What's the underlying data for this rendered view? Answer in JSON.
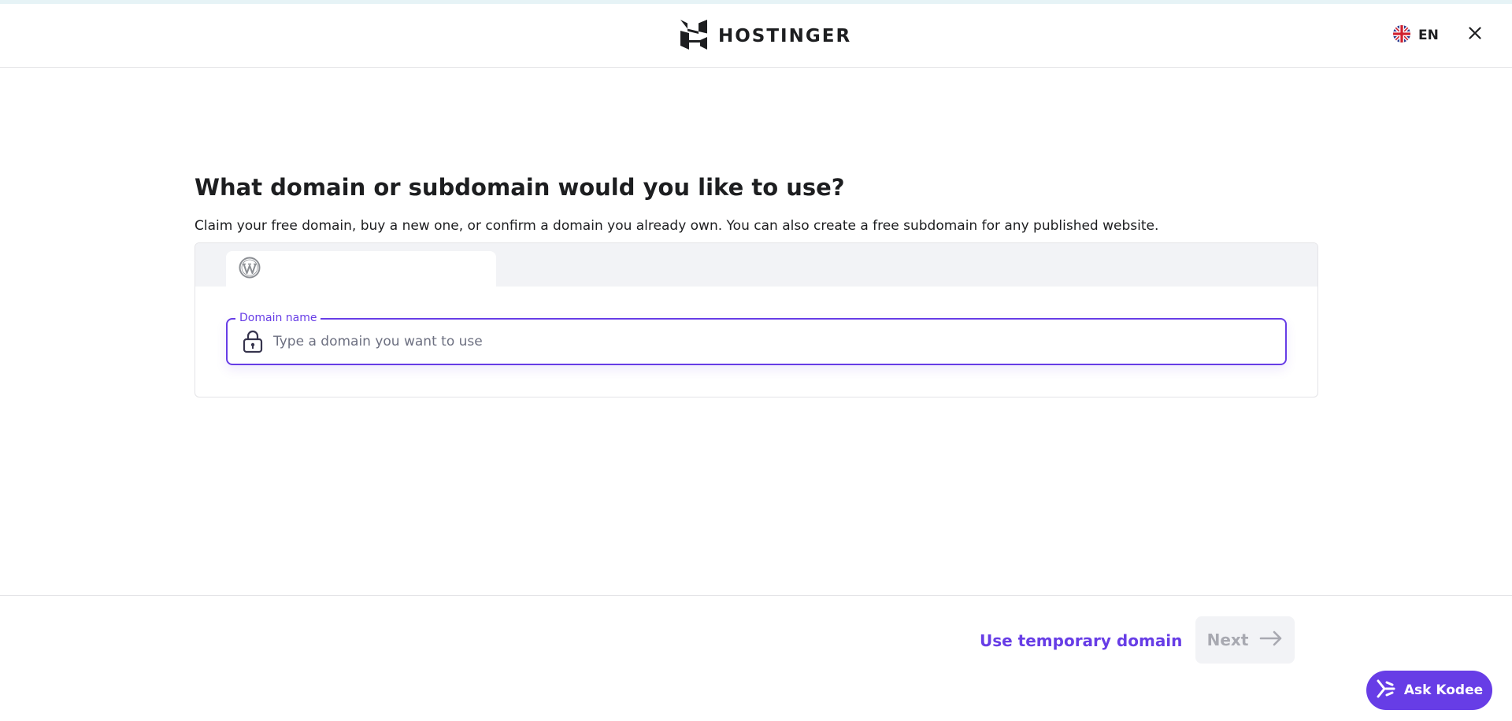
{
  "header": {
    "logo_text": "HOSTINGER",
    "language": "EN"
  },
  "main": {
    "title": "What domain or subdomain would you like to use?",
    "subtitle": "Claim your free domain, buy a new one, or confirm a domain you already own. You can also create a free subdomain for any published website.",
    "domain_field": {
      "label": "Domain name",
      "placeholder": "Type a domain you want to use",
      "value": ""
    }
  },
  "footer": {
    "temp_domain_label": "Use temporary domain",
    "next_label": "Next"
  },
  "assistant": {
    "label": "Ask Kodee"
  },
  "colors": {
    "accent": "#673de6",
    "disabled_text": "#a8a9b1",
    "disabled_bg": "#f2f3f6"
  },
  "icons": [
    "hostinger-logo-icon",
    "uk-flag-icon",
    "close-icon",
    "wordpress-icon",
    "lock-icon",
    "arrow-right-icon",
    "kodee-icon"
  ]
}
